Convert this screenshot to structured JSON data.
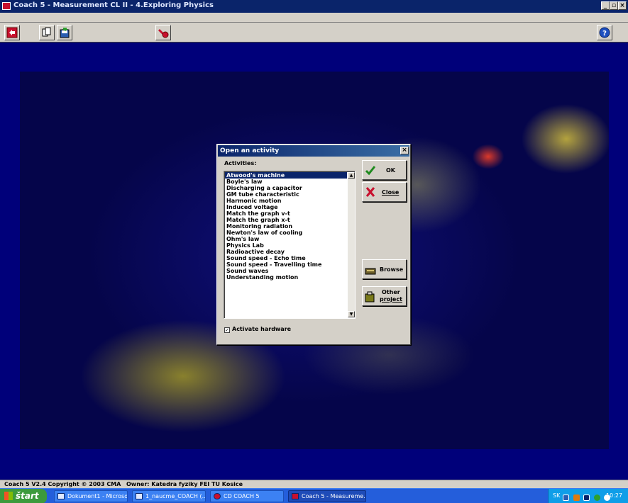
{
  "window": {
    "title": "Coach 5 - Measurement CL II - 4.Exploring Physics",
    "minimize": "_",
    "restore": "▫",
    "close": "×"
  },
  "toolbar": {
    "icons": [
      "exit-icon",
      "copy-icon",
      "save-icon",
      "tools-icon",
      "help-icon"
    ]
  },
  "dialog": {
    "title": "Open an activity",
    "close": "×",
    "activities_label": "Activities:",
    "activities": [
      "Atwood's machine",
      "Boyle's law",
      "Discharging a capacitor",
      "GM tube characteristic",
      "Harmonic motion",
      "Induced voltage",
      "Match the graph v-t",
      "Match the graph x-t",
      "Monitoring radiation",
      "Newton's law of cooling",
      "Ohm's law",
      "Physics Lab",
      "Radioactive decay",
      "Sound speed - Echo time",
      "Sound speed - Travelling time",
      "Sound waves",
      "Understanding motion"
    ],
    "selected_index": 0,
    "ok_label": "OK",
    "close_label": "Close",
    "browse_label": "Browse",
    "other_project_label_1": "Other",
    "other_project_label_2": "project",
    "activate_hardware_label": "Activate hardware",
    "activate_hardware_checked": true
  },
  "statusbar": {
    "copyright": "Coach 5 V2.4 Copyright © 2003 CMA",
    "owner": "Owner: Katedra fyziky FEI TU Kosice"
  },
  "taskbar": {
    "start_label": "štart",
    "tasks": [
      {
        "label": "Dokument1 - Microsof..."
      },
      {
        "label": "1_naucme_COACH (..."
      },
      {
        "label": "CD COACH 5"
      },
      {
        "label": "Coach 5 - Measureme..."
      }
    ],
    "active_task": 3,
    "tray_lang": "SK",
    "clock": "10:27"
  },
  "colors": {
    "desktop_bg": "#00007a",
    "titlebar": "#0a246a",
    "selection": "#0a246a",
    "taskbar": "#245edb",
    "start": "#3c9a3c"
  }
}
